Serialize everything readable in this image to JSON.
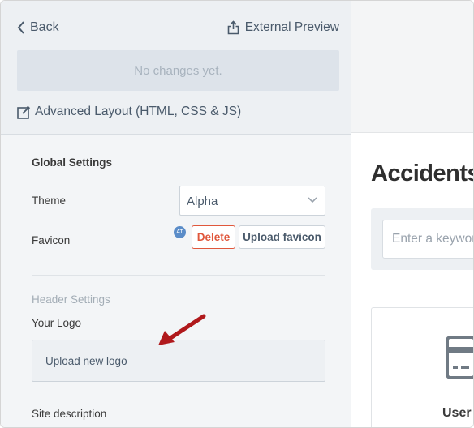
{
  "header": {
    "back_label": "Back",
    "external_preview_label": "External Preview",
    "changes_text": "No changes yet.",
    "advanced_layout_label": "Advanced Layout (HTML, CSS & JS)"
  },
  "global_settings": {
    "title": "Global Settings",
    "theme_label": "Theme",
    "theme_value": "Alpha",
    "favicon_label": "Favicon",
    "favicon_badge": "AT",
    "delete_label": "Delete",
    "upload_favicon_label": "Upload favicon"
  },
  "header_settings": {
    "title": "Header Settings",
    "logo_label": "Your Logo",
    "upload_logo_label": "Upload new logo",
    "site_description_label": "Site description"
  },
  "preview": {
    "headline": "Accidents",
    "search_placeholder": "Enter a keyword",
    "card_title": "User A"
  },
  "colors": {
    "accent_red": "#e0573c",
    "arrow": "#b0191c",
    "panel_bg": "#f3f5f7"
  }
}
